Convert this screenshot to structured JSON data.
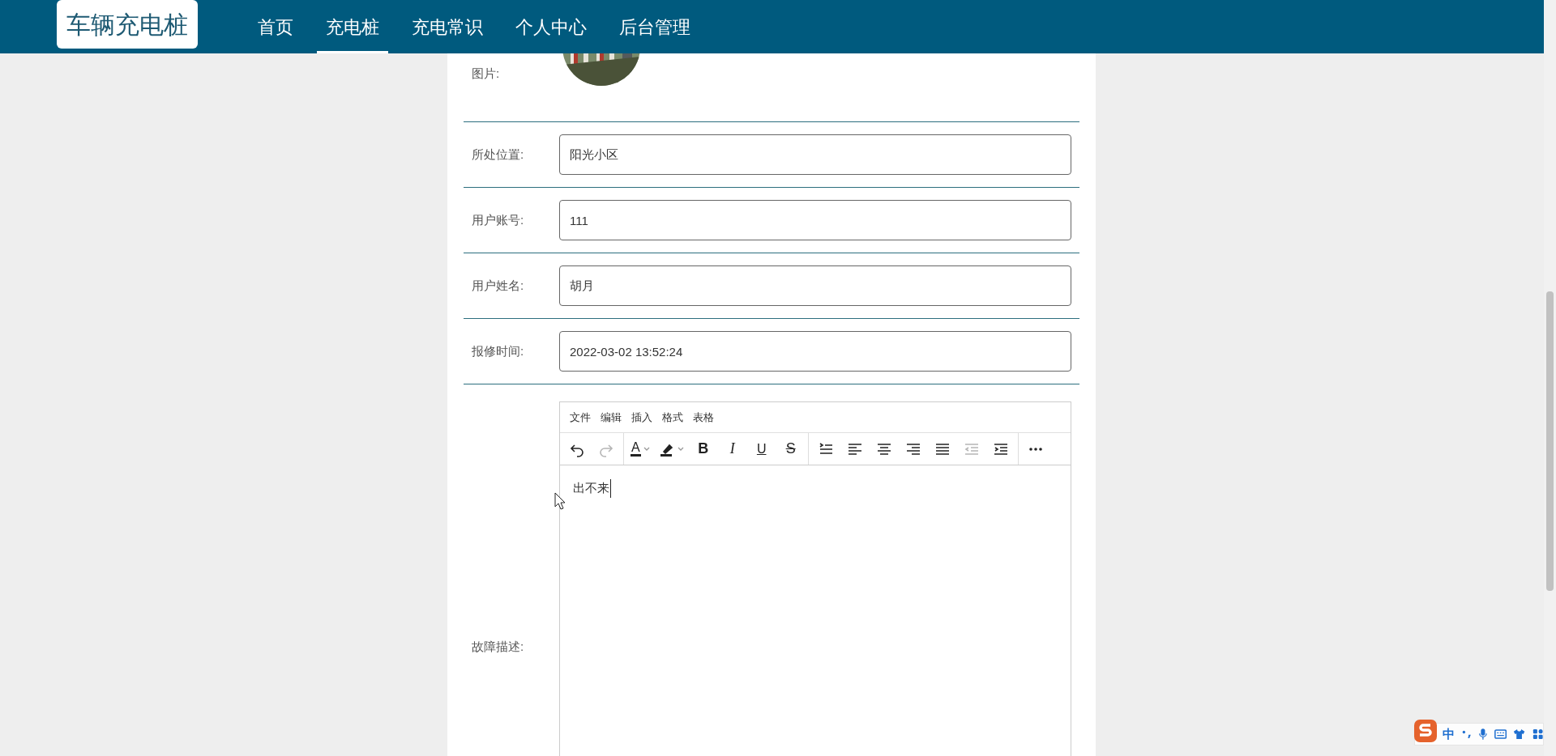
{
  "logo": "车辆充电桩",
  "nav": [
    {
      "label": "首页",
      "selected": false
    },
    {
      "label": "充电桩",
      "selected": true
    },
    {
      "label": "充电常识",
      "selected": false
    },
    {
      "label": "个人中心",
      "selected": false
    },
    {
      "label": "后台管理",
      "selected": false
    }
  ],
  "form": {
    "picture": {
      "label": "图片:",
      "kind": "picture"
    },
    "fields": [
      {
        "label": "所处位置:",
        "value": "阳光小区"
      },
      {
        "label": "用户账号:",
        "value": "111"
      },
      {
        "label": "用户姓名:",
        "value": "胡月"
      },
      {
        "label": "报修时间:",
        "value": "2022-03-02 13:52:24"
      }
    ],
    "editor": {
      "label": "故障描述:",
      "menu": [
        "文件",
        "编辑",
        "插入",
        "格式",
        "表格"
      ],
      "toolbar": [
        [
          {
            "kind": "undo",
            "disabled": false
          },
          {
            "kind": "redo",
            "disabled": true
          }
        ],
        [
          {
            "kind": "text-color",
            "label": "A",
            "disabled": false
          },
          {
            "kind": "highlight",
            "disabled": false
          },
          {
            "kind": "bold",
            "label": "B",
            "disabled": false
          },
          {
            "kind": "italic",
            "label": "I",
            "disabled": false
          },
          {
            "kind": "underline",
            "label": "U",
            "disabled": false
          },
          {
            "kind": "strike",
            "label": "S",
            "disabled": false
          }
        ],
        [
          {
            "kind": "numbered-list",
            "disabled": false
          },
          {
            "kind": "align-left",
            "disabled": false
          },
          {
            "kind": "align-center",
            "disabled": false
          },
          {
            "kind": "align-right",
            "disabled": false
          },
          {
            "kind": "justify",
            "disabled": false
          },
          {
            "kind": "outdent",
            "disabled": true
          },
          {
            "kind": "indent",
            "disabled": false
          }
        ],
        [
          {
            "kind": "more",
            "disabled": false
          }
        ]
      ],
      "content": "出不来"
    }
  },
  "ime": {
    "mode": "中"
  }
}
